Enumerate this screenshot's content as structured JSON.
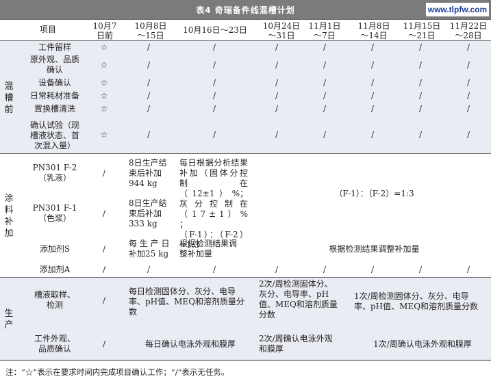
{
  "title": "表4  奇瑞备件线混槽计划",
  "watermark": "www.tlpfw.com",
  "header": {
    "item": "项目",
    "cols": [
      "10月7\n日前",
      "10月8日\n～15日",
      "10月16日～23日",
      "10月24日\n～31日",
      "11月1日\n～7日",
      "11月8日\n～14日",
      "11月15日\n～21日",
      "11月22日\n～28日"
    ]
  },
  "sections": {
    "mixing": "混\n槽\n前",
    "coating": "涂\n料\n补\n加",
    "production": "生\n产"
  },
  "star": "☆",
  "slash": "/",
  "rows": {
    "r1": "工件留样",
    "r2": "原外观、品质\n确认",
    "r3": "设备确认",
    "r4": "日常耗材准备",
    "r5": "置换槽清洗",
    "r6": "确认试验（现\n槽液状态、首\n次混入量）",
    "f2": {
      "label": "PN301 F-2\n（乳液）",
      "oct8": "8日生产结\n束后补加\n944 kg",
      "oct16": "每日根据分析结果\n补加（固体分控\n制在（12±1）%；\n灰 分 控 制 在\n（ 1 7 ± 1 ） % ；\n（F-1）：（F-2）\n=1:3"
    },
    "f1": {
      "label": "PN301 F-1\n（色浆）",
      "oct8": "8日生产结\n束后补加\n333 kg"
    },
    "ratio": "（F-1）：（F-2）=1:3",
    "addS": {
      "label": "添加剂S",
      "oct8": "每 生 产 日\n补加25 kg",
      "oct16": "根据检测结果调\n整补加量",
      "later": "根据检测结果调整补加量"
    },
    "addA": {
      "label": "添加剂A"
    },
    "bath": {
      "label": "槽液取样、\n检测",
      "daily": "每日检测固体分、灰分、电导\n率、pH值、MEQ和溶剂质量分\n数",
      "twice": "2次/周检测固体分、\n灰分、电导率、pH\n值、MEQ和溶剂质量\n分数",
      "once": "1次/周检测固体分、灰分、电导\n率、pH值、MEQ和溶剂质量分数"
    },
    "look": {
      "label": "工件外观、\n品质确认",
      "daily": "每日确认电泳外观和膜厚",
      "twice": "2次/周确认电泳外观\n和膜厚",
      "once": "1次/周确认电泳外观和膜厚"
    }
  },
  "note": "注：“☆”表示在要求时间内完成项目确认工作；“/”表示无任务。",
  "colors": {
    "title_bg": "#7b7b7b",
    "band_bg": "#e9ecf3",
    "watermark": "#1f3f9c"
  }
}
